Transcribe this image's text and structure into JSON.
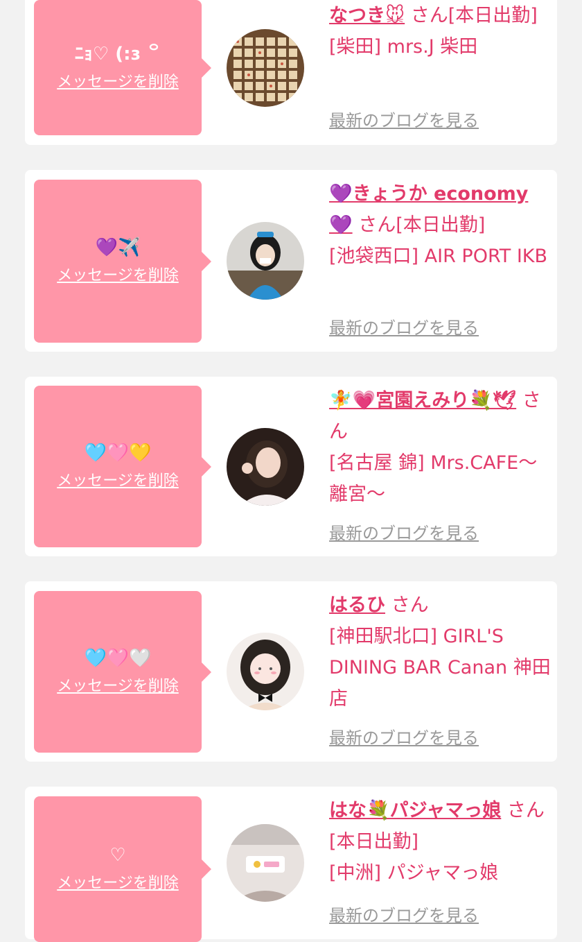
{
  "messages": [
    {
      "text": "ﾆｮ♡ (:ɜ ꒪",
      "delete_label": "メッセージを削除",
      "name": "なつき🐭",
      "suffix": "さん[本日出勤]",
      "shop": "[柴田] mrs.J 柴田",
      "blog_label": "最新のブログを見る",
      "avatar": "grid-icon"
    },
    {
      "text": "💜✈️",
      "delete_label": "メッセージを削除",
      "name": "💜きょうか economy 💜",
      "suffix": "さん[本日出勤]",
      "shop": "[池袋西口] AIR PORT IKB",
      "blog_label": "最新のブログを見る",
      "avatar": "person-icon"
    },
    {
      "text": "🩵🩷💛",
      "delete_label": "メッセージを削除",
      "name": "🧚💗宮園えみり💐🕊",
      "suffix": "さん",
      "shop": "[名古屋 錦] Mrs.CAFE〜離宮〜",
      "blog_label": "最新のブログを見る",
      "avatar": "person-icon"
    },
    {
      "text": "🩵🩷🤍",
      "delete_label": "メッセージを削除",
      "name": "はるひ",
      "suffix": "さん",
      "shop": "[神田駅北口] GIRL'S DINING BAR Canan 神田店",
      "blog_label": "最新のブログを見る",
      "avatar": "person-icon"
    },
    {
      "text": "♡",
      "delete_label": "メッセージを削除",
      "name": "はな💐パジャマっ娘",
      "suffix": "さん[本日出勤]",
      "shop": "[中洲] パジャマっ娘",
      "blog_label": "最新のブログを見る",
      "avatar": "logo-icon"
    }
  ],
  "colors": {
    "background": "#f2f2f2",
    "bubble": "#ff96a8",
    "name": "#e23a6a",
    "link_gray": "#999999"
  }
}
